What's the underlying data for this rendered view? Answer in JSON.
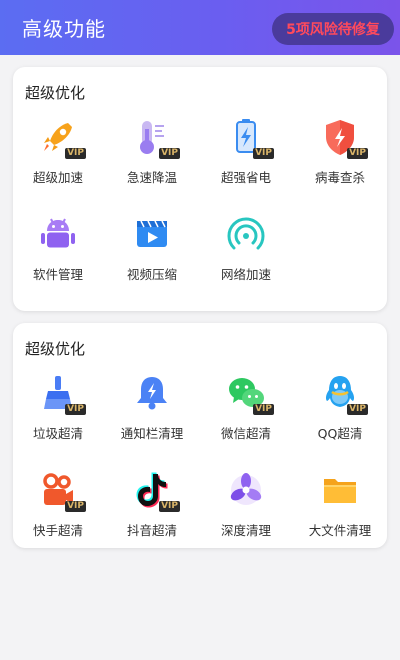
{
  "header": {
    "title": "高级功能",
    "risk_badge": "5项风险待修复"
  },
  "section1": {
    "title": "超级优化",
    "items": [
      {
        "label": "超级加速",
        "icon": "rocket-icon",
        "vip": "VIP"
      },
      {
        "label": "急速降温",
        "icon": "thermometer-icon",
        "vip": "VIP"
      },
      {
        "label": "超强省电",
        "icon": "battery-icon",
        "vip": "VIP"
      },
      {
        "label": "病毒查杀",
        "icon": "shield-icon",
        "vip": "VIP"
      },
      {
        "label": "软件管理",
        "icon": "android-icon"
      },
      {
        "label": "视频压缩",
        "icon": "video-icon"
      },
      {
        "label": "网络加速",
        "icon": "wifi-icon"
      }
    ]
  },
  "section2": {
    "title": "超级优化",
    "items": [
      {
        "label": "垃圾超清",
        "icon": "broom-icon",
        "vip": "VIP"
      },
      {
        "label": "通知栏清理",
        "icon": "bell-icon"
      },
      {
        "label": "微信超清",
        "icon": "wechat-icon",
        "vip": "VIP"
      },
      {
        "label": "QQ超清",
        "icon": "qq-icon",
        "vip": "VIP"
      },
      {
        "label": "快手超清",
        "icon": "kuaishou-icon",
        "vip": "VIP"
      },
      {
        "label": "抖音超清",
        "icon": "douyin-icon",
        "vip": "VIP"
      },
      {
        "label": "深度清理",
        "icon": "fan-icon"
      },
      {
        "label": "大文件清理",
        "icon": "folder-icon"
      }
    ]
  },
  "colors": {
    "header_start": "#5b6df2",
    "header_end": "#7b54ea",
    "badge_bg": "#4a3b9c",
    "badge_text": "#ff4a5c",
    "vip_bg": "#2a2a2a",
    "vip_text": "#d9b468"
  }
}
